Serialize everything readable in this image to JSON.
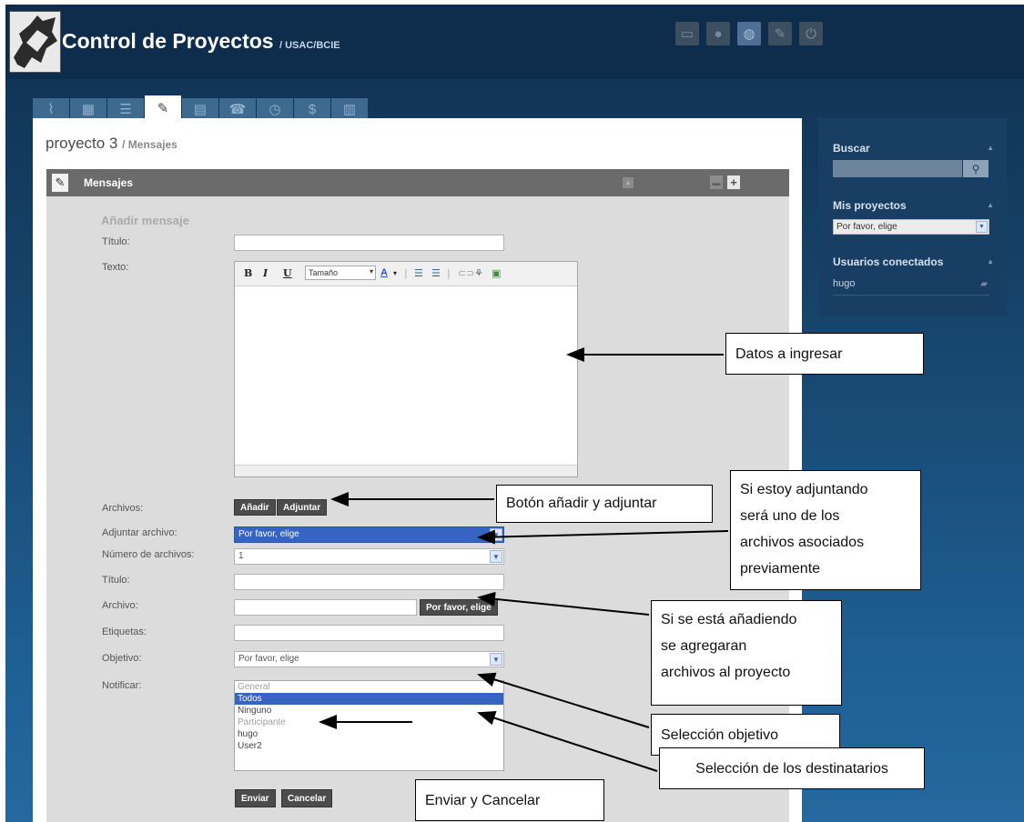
{
  "header": {
    "app_title": "Control de Proyectos",
    "app_subtitle": "/ USAC/BCIE",
    "icons": [
      "monitor-icon",
      "user-icon",
      "globe-icon",
      "wrench-icon",
      "power-icon"
    ]
  },
  "tabs": [
    {
      "icon": "antenna-icon"
    },
    {
      "icon": "calendar-icon"
    },
    {
      "icon": "checklist-icon"
    },
    {
      "icon": "edit-note-icon",
      "active": true
    },
    {
      "icon": "calculator-icon"
    },
    {
      "icon": "phone-icon"
    },
    {
      "icon": "clock-icon"
    },
    {
      "icon": "money-bag-icon"
    },
    {
      "icon": "clipboard-icon"
    }
  ],
  "page": {
    "project": "proyecto 3",
    "section": "/ Mensajes"
  },
  "panel": {
    "title": "Mensajes",
    "section_title": "Añadir mensaje"
  },
  "form": {
    "titulo_label": "Título:",
    "texto_label": "Texto:",
    "editor": {
      "bold": "B",
      "italic": "I",
      "underline": "U",
      "size_placeholder": "Tamaño",
      "font_color": "A"
    },
    "archivos_label": "Archivos:",
    "btn_anadir": "Añadir",
    "btn_adjuntar": "Adjuntar",
    "adjuntar_label": "Adjuntar archivo:",
    "adjuntar_value": "Por favor, elige",
    "numero_label": "Número de archivos:",
    "numero_value": "1",
    "titulo2_label": "Título:",
    "archivo_label": "Archivo:",
    "archivo_button": "Por favor, elige",
    "etiquetas_label": "Etiquetas:",
    "objetivo_label": "Objetivo:",
    "objetivo_value": "Por favor, elige",
    "notificar_label": "Notificar:",
    "notificar_options": [
      {
        "label": "General",
        "group": true
      },
      {
        "label": "Todos",
        "selected": true
      },
      {
        "label": "Ninguno"
      },
      {
        "label": "Participante",
        "group": true
      },
      {
        "label": "hugo"
      },
      {
        "label": "User2"
      }
    ],
    "btn_enviar": "Enviar",
    "btn_cancelar": "Cancelar"
  },
  "sidebar": {
    "buscar_title": "Buscar",
    "proyectos_title": "Mis proyectos",
    "proyectos_value": "Por favor, elige",
    "usuarios_title": "Usuarios conectados",
    "users": [
      "hugo"
    ]
  },
  "annotations": {
    "datos": "Datos a ingresar",
    "boton": "Botón añadir y adjuntar",
    "adjuntando": [
      "Si estoy adjuntando",
      "será uno de los",
      "archivos asociados",
      "previamente"
    ],
    "anadiendo": [
      "Si se está añadiendo",
      "se agregaran",
      "archivos al proyecto"
    ],
    "objetivo": "Selección objetivo",
    "destinatarios": "Selección de los destinatarios",
    "enviar": "Enviar y Cancelar"
  },
  "colors": {
    "header_bg": "#0e2c4c",
    "panel_header": "#6b6b6b",
    "selection_blue": "#3564c4",
    "button_dark": "#4c4c4c"
  }
}
